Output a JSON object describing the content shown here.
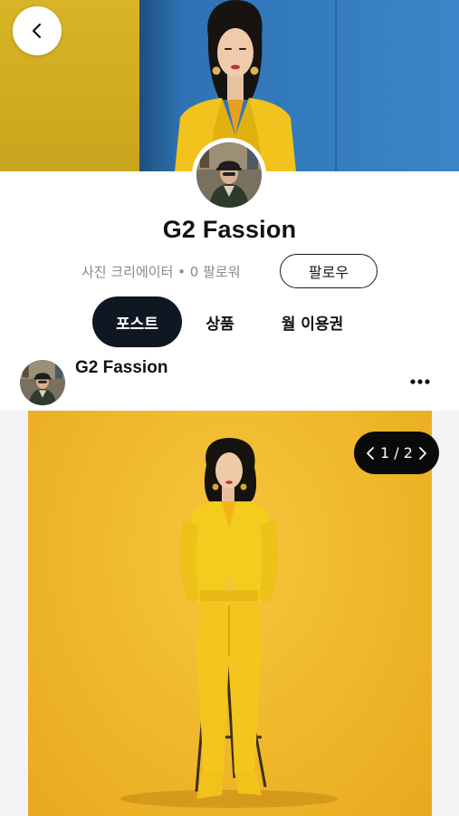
{
  "profile": {
    "name": "G2 Fassion",
    "category": "사진 크리에이터",
    "separator": "•",
    "followers": "0 팔로워",
    "follow_label": "팔로우"
  },
  "tabs": [
    {
      "label": "포스트",
      "active": true
    },
    {
      "label": "상품",
      "active": false
    },
    {
      "label": "월 이용권",
      "active": false
    }
  ],
  "post": {
    "author": "G2 Fassion",
    "pager": {
      "current": "1",
      "separator": "/",
      "total": "2"
    }
  },
  "colors": {
    "accent_dark": "#0f1722",
    "cover_blue": "#2f74b6",
    "cover_yellow": "#d8b526",
    "post_bg_yellow": "#efb72a",
    "muted_text": "#8a8a8a"
  },
  "icons": {
    "back": "chevron-left-icon",
    "more": "more-horizontal-icon",
    "pager_prev": "chevron-left-icon",
    "pager_next": "chevron-right-icon"
  }
}
